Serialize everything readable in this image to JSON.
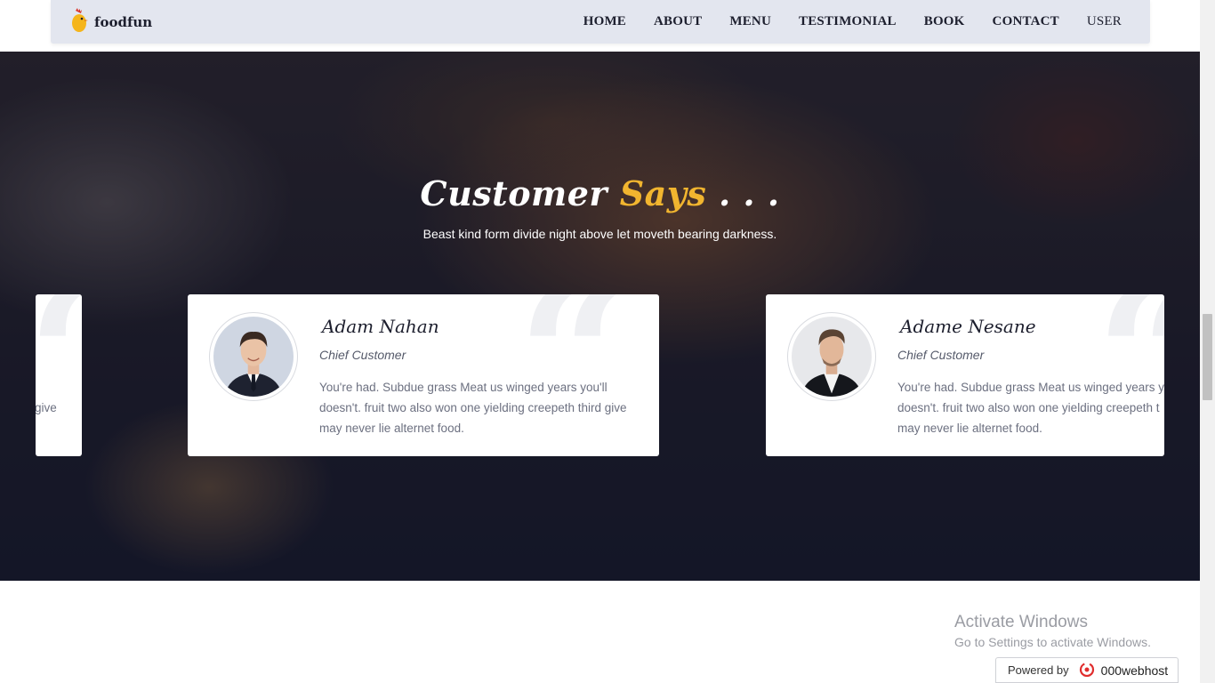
{
  "brand": {
    "name": "foodfun",
    "icon": "chicken-logo-icon"
  },
  "nav": {
    "items": [
      {
        "label": "HOME"
      },
      {
        "label": "ABOUT"
      },
      {
        "label": "MENU"
      },
      {
        "label": "TESTIMONIAL"
      },
      {
        "label": "BOOK"
      },
      {
        "label": "CONTACT"
      },
      {
        "label": "USER"
      }
    ]
  },
  "section": {
    "title_main": "Customer ",
    "title_accent": "Says",
    "title_tail": " . . .",
    "subtitle": "Beast kind form divide night above let moveth bearing darkness.",
    "accent_color": "#f1b52f"
  },
  "testimonials": [
    {
      "partial_text": "give"
    },
    {
      "name": "Adam Nahan",
      "role": "Chief Customer",
      "text": "You're had. Subdue grass Meat us winged years you'll doesn't. fruit two also won one yielding creepeth third give may never lie alternet food."
    },
    {
      "name": "Adame Nesane",
      "role": "Chief Customer",
      "line1": "You're had. Subdue grass Meat us winged years yo",
      "line2": "doesn't. fruit two also won one yielding creepeth t",
      "line3": "may never lie alternet food."
    }
  ],
  "quote_glyph": "“",
  "watermark": {
    "title": "Activate Windows",
    "subtitle": "Go to Settings to activate Windows."
  },
  "hosting": {
    "prefix": "Powered by",
    "brand": "000webhost"
  }
}
